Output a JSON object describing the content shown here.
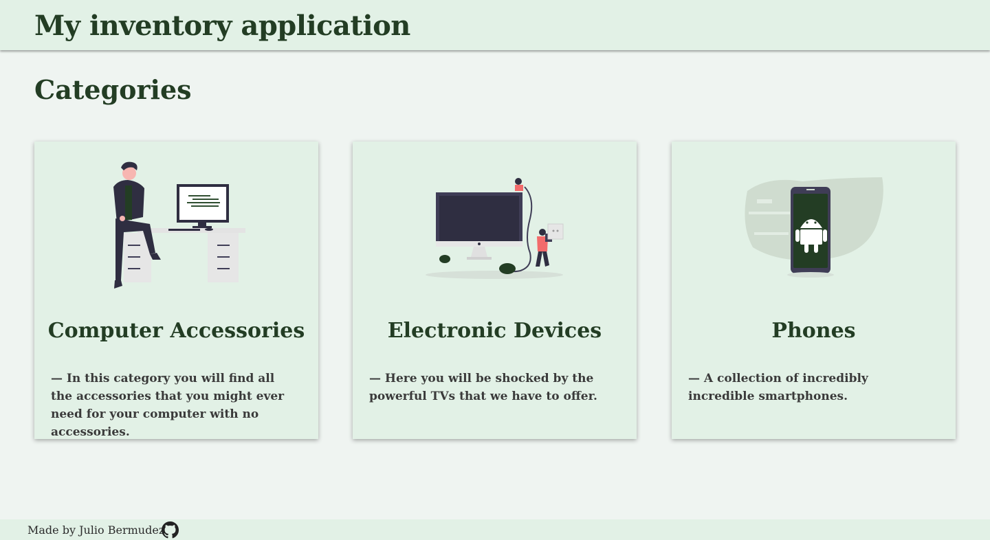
{
  "header": {
    "title": "My inventory application"
  },
  "main": {
    "section_title": "Categories",
    "categories": [
      {
        "title": "Computer Accessories",
        "description": "— In this category you will find all the accessories that you might ever need for your computer with no accessories.",
        "illustration": "person-at-desk-computer"
      },
      {
        "title": "Electronic Devices",
        "description": "— Here you will be shocked by the powerful TVs that we have to offer.",
        "illustration": "tv-with-plug-people"
      },
      {
        "title": "Phones",
        "description": "— A collection of incredibly incredible smartphones.",
        "illustration": "android-phone"
      }
    ]
  },
  "footer": {
    "text": "Made by Julio Bermudez",
    "icon": "github-icon"
  },
  "colors": {
    "accent": "#233d24",
    "card_bg": "#e2f1e6",
    "page_bg": "#eff4f1",
    "highlight": "#f26b6b"
  }
}
